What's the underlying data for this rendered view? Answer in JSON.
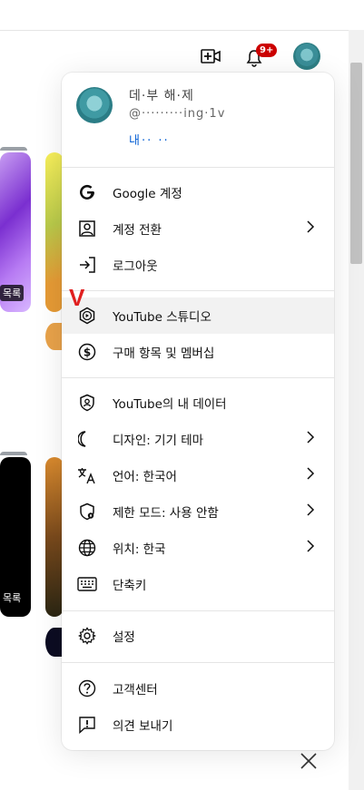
{
  "header": {
    "create_icon": "video-plus-icon",
    "notifications_badge": "9+"
  },
  "background": {
    "playlist_tag_1": "목록",
    "playlist_tag_2": "목록"
  },
  "account": {
    "name": "데·부 해·제",
    "handle": "@·········ing·1v",
    "link": "내·· ··"
  },
  "menu": {
    "google_account": "Google 계정",
    "switch_account": "계정 전환",
    "sign_out": "로그아웃",
    "youtube_studio": "YouTube 스튜디오",
    "purchases": "구매 항목 및 멤버십",
    "your_data": "YouTube의 내 데이터",
    "appearance": "디자인: 기기 테마",
    "language": "언어: 한국어",
    "restricted": "제한 모드: 사용 안함",
    "location": "위치: 한국",
    "shortcuts": "단축키",
    "settings": "설정",
    "help": "고객센터",
    "feedback": "의견 보내기"
  },
  "annotation": {
    "mark": "V",
    "color": "#e02020"
  },
  "colors": {
    "badge": "#cc0000",
    "link": "#065fd4",
    "highlight": "#f2f2f2"
  }
}
